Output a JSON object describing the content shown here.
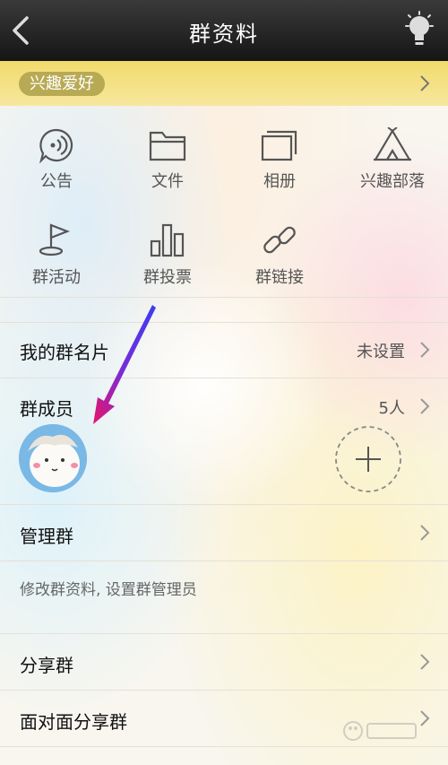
{
  "header": {
    "title": "群资料",
    "back_icon": "chevron-left-icon",
    "theme_icon": "lightbulb-icon"
  },
  "interest_tag": {
    "label": "兴趣爱好"
  },
  "features": [
    {
      "label": "公告",
      "icon": "announcement-icon"
    },
    {
      "label": "文件",
      "icon": "folder-icon"
    },
    {
      "label": "相册",
      "icon": "album-icon"
    },
    {
      "label": "兴趣部落",
      "icon": "tent-icon"
    },
    {
      "label": "群活动",
      "icon": "flag-icon"
    },
    {
      "label": "群投票",
      "icon": "bar-chart-icon"
    },
    {
      "label": "群链接",
      "icon": "link-icon"
    }
  ],
  "my_card": {
    "label": "我的群名片",
    "value": "未设置"
  },
  "members": {
    "label": "群成员",
    "count": "5人"
  },
  "manage": {
    "label": "管理群",
    "hint": "修改群资料, 设置群管理员"
  },
  "share": {
    "label": "分享群"
  },
  "face_share": {
    "label": "面对面分享群"
  },
  "colors": {
    "accent": "#f1db6c",
    "arrow": "#e8126b"
  }
}
